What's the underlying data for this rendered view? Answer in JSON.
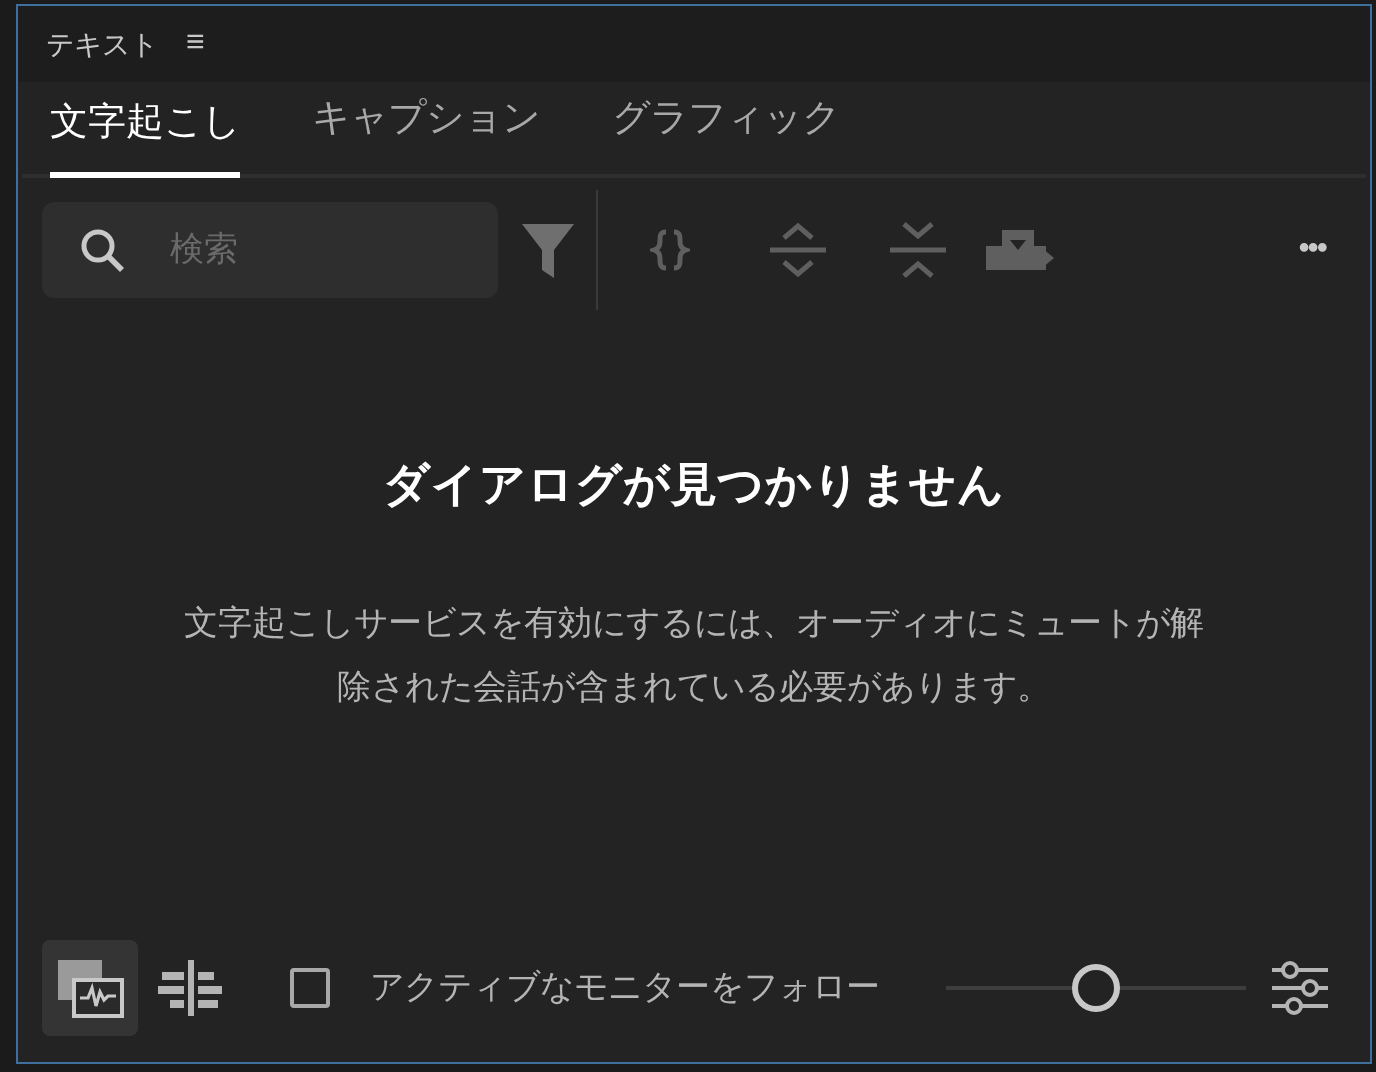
{
  "panel": {
    "title": "テキスト",
    "menu": "≡"
  },
  "tabs": [
    {
      "label": "文字起こし",
      "selected": true
    },
    {
      "label": "キャプション",
      "selected": false
    },
    {
      "label": "グラフィック",
      "selected": false
    }
  ],
  "search": {
    "placeholder": "検索"
  },
  "toolbar": {
    "more": "•••"
  },
  "empty_state": {
    "heading": "ダイアログが見つかりません",
    "message": "文字起こしサービスを有効にするには、オーディオにミュートが解除された会話が含まれている必要があります。"
  },
  "footer": {
    "view_buttons": [
      {
        "selected": true
      },
      {
        "selected": false
      }
    ],
    "follow_monitor": {
      "label": "アクティブなモニターをフォロー",
      "checked": false
    },
    "zoom": {
      "level": 0.5
    }
  }
}
